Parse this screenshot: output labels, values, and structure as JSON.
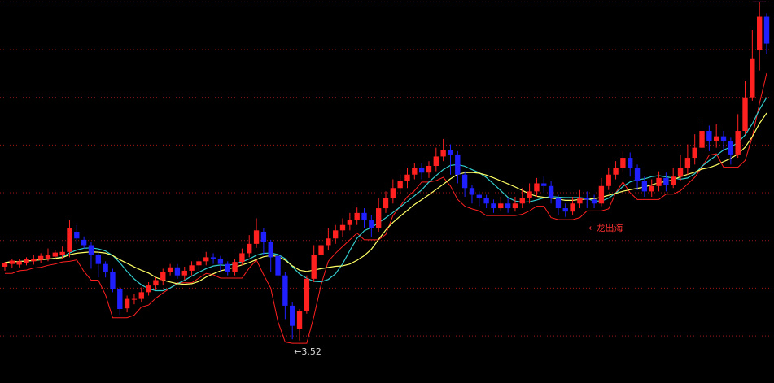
{
  "chart_data": {
    "type": "candlestick",
    "title": "",
    "xlabel": "",
    "ylabel": "",
    "ylim": [
      3.3,
      8.6
    ],
    "grid": "horizontal-dotted",
    "gridlines": [
      3.65,
      4.36,
      5.07,
      5.78,
      6.49,
      7.2,
      7.91,
      8.62
    ],
    "colors": {
      "up": "#ff2020",
      "down": "#2020ff",
      "bg": "#000000",
      "grid": "#a01818",
      "ma_fast": "#ffff66",
      "ma_slow": "#33cccc",
      "envelope": "#ff2020"
    },
    "candles": [
      [
        4.68,
        4.74,
        4.62,
        4.75
      ],
      [
        4.72,
        4.77,
        4.66,
        4.79
      ],
      [
        4.71,
        4.76,
        4.67,
        4.8
      ],
      [
        4.74,
        4.79,
        4.7,
        4.82
      ],
      [
        4.76,
        4.8,
        4.71,
        4.86
      ],
      [
        4.78,
        4.84,
        4.74,
        4.88
      ],
      [
        4.8,
        4.85,
        4.76,
        4.95
      ],
      [
        4.83,
        4.89,
        4.79,
        4.93
      ],
      [
        4.86,
        4.9,
        4.8,
        4.98
      ],
      [
        4.9,
        5.25,
        4.82,
        5.38
      ],
      [
        5.2,
        5.1,
        5.02,
        5.3
      ],
      [
        5.08,
        5.0,
        4.95,
        5.13
      ],
      [
        5.0,
        4.85,
        4.65,
        5.05
      ],
      [
        4.86,
        4.72,
        4.52,
        4.9
      ],
      [
        4.72,
        4.6,
        4.52,
        4.76
      ],
      [
        4.6,
        4.35,
        4.3,
        4.65
      ],
      [
        4.35,
        4.05,
        3.96,
        4.38
      ],
      [
        4.06,
        4.2,
        4.0,
        4.25
      ],
      [
        4.2,
        4.2,
        4.12,
        4.28
      ],
      [
        4.2,
        4.3,
        4.15,
        4.37
      ],
      [
        4.3,
        4.4,
        4.25,
        4.45
      ],
      [
        4.4,
        4.48,
        4.33,
        4.52
      ],
      [
        4.48,
        4.6,
        4.4,
        4.65
      ],
      [
        4.6,
        4.67,
        4.55,
        4.72
      ],
      [
        4.67,
        4.55,
        4.5,
        4.72
      ],
      [
        4.55,
        4.62,
        4.48,
        4.68
      ],
      [
        4.62,
        4.7,
        4.55,
        4.76
      ],
      [
        4.7,
        4.76,
        4.62,
        4.82
      ],
      [
        4.76,
        4.82,
        4.7,
        4.9
      ],
      [
        4.82,
        4.8,
        4.72,
        4.88
      ],
      [
        4.8,
        4.72,
        4.6,
        4.84
      ],
      [
        4.72,
        4.6,
        4.55,
        4.76
      ],
      [
        4.6,
        4.75,
        4.55,
        4.8
      ],
      [
        4.75,
        4.88,
        4.7,
        4.95
      ],
      [
        4.88,
        5.02,
        4.82,
        5.15
      ],
      [
        5.02,
        5.22,
        4.96,
        5.4
      ],
      [
        5.2,
        5.05,
        4.85,
        5.25
      ],
      [
        5.05,
        4.82,
        4.6,
        5.08
      ],
      [
        4.84,
        4.55,
        4.4,
        4.88
      ],
      [
        4.55,
        4.1,
        3.9,
        4.6
      ],
      [
        4.1,
        3.8,
        3.6,
        4.15
      ],
      [
        3.75,
        4.02,
        3.58,
        4.05
      ],
      [
        4.02,
        4.5,
        3.98,
        4.55
      ],
      [
        4.5,
        4.85,
        4.45,
        5.0
      ],
      [
        4.85,
        5.0,
        4.8,
        5.2
      ],
      [
        5.0,
        5.1,
        4.92,
        5.25
      ],
      [
        5.1,
        5.22,
        5.02,
        5.3
      ],
      [
        5.22,
        5.3,
        5.12,
        5.4
      ],
      [
        5.3,
        5.38,
        5.22,
        5.48
      ],
      [
        5.38,
        5.48,
        5.3,
        5.56
      ],
      [
        5.48,
        5.38,
        5.25,
        5.55
      ],
      [
        5.38,
        5.25,
        5.12,
        5.45
      ],
      [
        5.25,
        5.55,
        5.2,
        5.7
      ],
      [
        5.55,
        5.7,
        5.48,
        5.8
      ],
      [
        5.7,
        5.85,
        5.62,
        5.98
      ],
      [
        5.85,
        5.95,
        5.76,
        6.05
      ],
      [
        5.95,
        6.05,
        5.85,
        6.15
      ],
      [
        6.05,
        6.15,
        5.98,
        6.22
      ],
      [
        6.15,
        6.08,
        5.98,
        6.22
      ],
      [
        6.08,
        6.18,
        6.0,
        6.25
      ],
      [
        6.18,
        6.32,
        6.1,
        6.45
      ],
      [
        6.32,
        6.42,
        6.25,
        6.58
      ],
      [
        6.42,
        6.35,
        6.05,
        6.5
      ],
      [
        6.35,
        6.05,
        5.92,
        6.4
      ],
      [
        6.05,
        5.85,
        5.72,
        6.1
      ],
      [
        5.85,
        5.75,
        5.62,
        5.9
      ],
      [
        5.75,
        5.7,
        5.58,
        5.8
      ],
      [
        5.7,
        5.62,
        5.55,
        5.75
      ],
      [
        5.62,
        5.55,
        5.48,
        5.68
      ],
      [
        5.55,
        5.62,
        5.5,
        5.72
      ],
      [
        5.62,
        5.55,
        5.48,
        5.7
      ],
      [
        5.55,
        5.62,
        5.5,
        5.72
      ],
      [
        5.62,
        5.7,
        5.55,
        5.85
      ],
      [
        5.7,
        5.8,
        5.62,
        5.92
      ],
      [
        5.8,
        5.92,
        5.72,
        6.0
      ],
      [
        5.92,
        5.88,
        5.78,
        6.02
      ],
      [
        5.88,
        5.7,
        5.62,
        5.95
      ],
      [
        5.7,
        5.55,
        5.45,
        5.75
      ],
      [
        5.55,
        5.5,
        5.42,
        5.62
      ],
      [
        5.5,
        5.62,
        5.45,
        5.72
      ],
      [
        5.62,
        5.7,
        5.55,
        5.82
      ],
      [
        5.7,
        5.68,
        5.55,
        5.8
      ],
      [
        5.68,
        5.62,
        5.55,
        5.75
      ],
      [
        5.62,
        5.88,
        5.58,
        6.0
      ],
      [
        5.88,
        6.05,
        5.82,
        6.15
      ],
      [
        6.05,
        6.15,
        5.98,
        6.25
      ],
      [
        6.15,
        6.3,
        6.08,
        6.4
      ],
      [
        6.3,
        6.15,
        6.02,
        6.38
      ],
      [
        6.15,
        5.95,
        5.82,
        6.2
      ],
      [
        5.95,
        5.8,
        5.72,
        6.02
      ],
      [
        5.8,
        5.88,
        5.72,
        5.98
      ],
      [
        5.88,
        6.0,
        5.8,
        6.1
      ],
      [
        6.0,
        5.9,
        5.8,
        6.08
      ],
      [
        5.9,
        6.02,
        5.85,
        6.15
      ],
      [
        6.02,
        6.15,
        5.95,
        6.35
      ],
      [
        6.15,
        6.3,
        6.05,
        6.5
      ],
      [
        6.3,
        6.45,
        6.2,
        6.65
      ],
      [
        6.45,
        6.7,
        6.38,
        6.85
      ],
      [
        6.7,
        6.55,
        6.4,
        6.78
      ],
      [
        6.55,
        6.62,
        6.45,
        6.8
      ],
      [
        6.62,
        6.55,
        6.4,
        6.7
      ],
      [
        6.55,
        6.35,
        6.2,
        6.6
      ],
      [
        6.35,
        6.7,
        6.3,
        6.95
      ],
      [
        6.7,
        7.2,
        6.65,
        7.45
      ],
      [
        7.2,
        7.78,
        7.15,
        8.2
      ],
      [
        7.9,
        8.4,
        7.6,
        8.62
      ],
      [
        8.4,
        8.0,
        7.85,
        8.45
      ]
    ],
    "annotations": [
      {
        "text": "←3.52",
        "candle": 40,
        "value": 3.52,
        "side": "below"
      },
      {
        "text": "←龙出海",
        "candle": 81,
        "value": 5.36,
        "side": "below"
      }
    ]
  }
}
